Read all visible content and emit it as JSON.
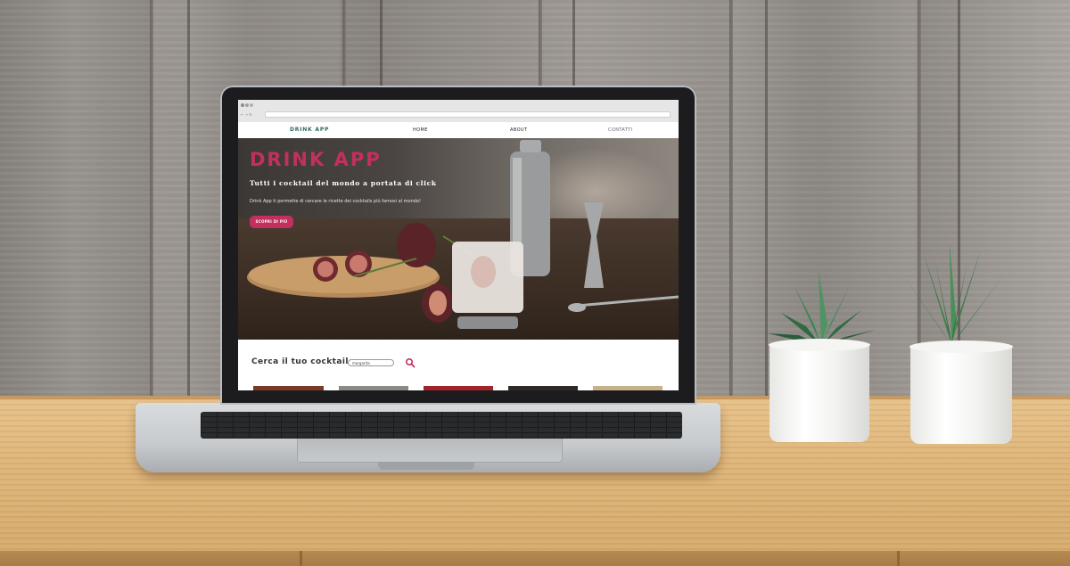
{
  "browser": {
    "url": "",
    "controls": "← → ↻"
  },
  "site": {
    "brand": "DRINK APP",
    "nav": [
      "HOME",
      "ABOUT",
      "CONTATTI"
    ]
  },
  "hero": {
    "title": "DRINK APP",
    "subtitle": "Tutti i cocktail del mondo a portata di click",
    "description": "Drink App ti permette di cercare le ricette dei cocktails più famosi al mondo!",
    "button_label": "SCOPRI DI PIÙ"
  },
  "search": {
    "title": "Cerca il tuo cocktail",
    "input_value": "margarita",
    "icon": "search-icon"
  },
  "colors": {
    "accent": "#c2305f",
    "brand": "#2d6b5a"
  }
}
